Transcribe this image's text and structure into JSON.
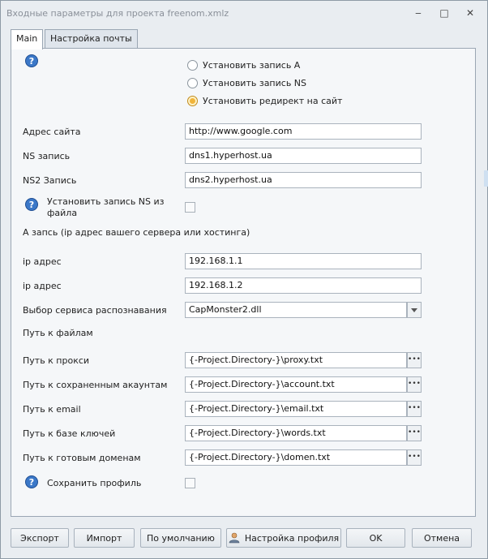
{
  "window": {
    "title": "Входные параметры для проекта freenom.xmlz",
    "controls": {
      "minimize": "‒",
      "maximize": "□",
      "close": "✕"
    }
  },
  "tabs": [
    {
      "label": "Main",
      "active": true
    },
    {
      "label": "Настройка почты",
      "active": false
    }
  ],
  "main": {
    "help_glyph": "?",
    "radio_options": [
      {
        "label": "Установить запись A",
        "checked": false
      },
      {
        "label": "Установить запись NS",
        "checked": false
      },
      {
        "label": "Установить редирект на сайт",
        "checked": true
      }
    ],
    "site_address": {
      "label": "Адрес сайта",
      "value": "http://www.google.com"
    },
    "ns_record": {
      "label": "NS запись",
      "value": "dns1.hyperhost.ua"
    },
    "ns2_record": {
      "label": "NS2 Запись",
      "value": "dns2.hyperhost.ua"
    },
    "ns_from_file": {
      "label_line1": "Установить запись NS из",
      "label_line2": "файла",
      "checked": false
    },
    "a_record_heading": "A запсь (ip адрес вашего сервера или хостинга)",
    "ip1": {
      "label": "ip адрес",
      "value": "192.168.1.1"
    },
    "ip2": {
      "label": "ip адрес",
      "value": "192.168.1.2"
    },
    "recognition_service": {
      "label": "Выбор сервиса распознавания",
      "value": "CapMonster2.dll"
    },
    "paths_heading": "Путь к файлам",
    "paths": [
      {
        "label": "Путь к прокси",
        "value": "{-Project.Directory-}\\proxy.txt"
      },
      {
        "label": "Путь к сохраненным акаунтам",
        "value": "{-Project.Directory-}\\account.txt"
      },
      {
        "label": "Путь к email",
        "value": "{-Project.Directory-}\\email.txt"
      },
      {
        "label": "Путь к базе ключей",
        "value": "{-Project.Directory-}\\words.txt"
      },
      {
        "label": "Путь к готовым доменам",
        "value": "{-Project.Directory-}\\domen.txt"
      }
    ],
    "browse_glyph": "•••",
    "save_profile": {
      "label": "Сохранить профиль",
      "checked": false
    }
  },
  "footer": {
    "export": "Экспорт",
    "import": "Импорт",
    "default": "По умолчанию",
    "profile_settings": "Настройка профиля",
    "ok": "OK",
    "cancel": "Отмена"
  },
  "colors": {
    "accent_help": "#3b78c8",
    "radio_checked": "#f1b43a"
  }
}
